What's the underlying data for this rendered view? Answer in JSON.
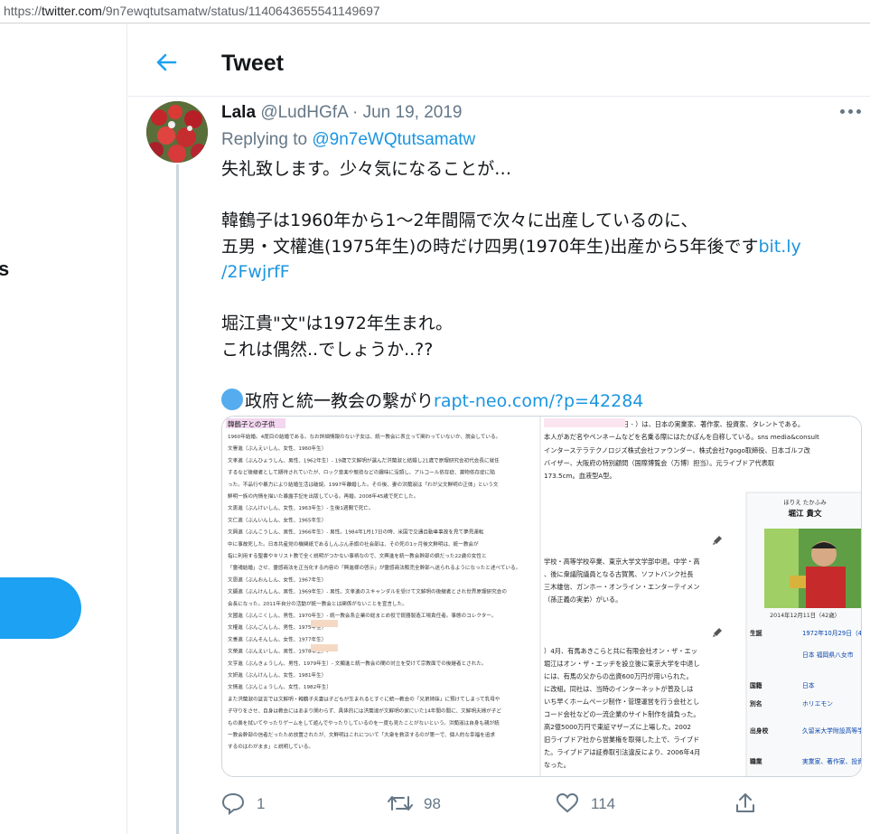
{
  "browser": {
    "url_prefix": "https://",
    "url_domain": "twitter.com",
    "url_path": "/9n7ewqtutsamatw/status/1140643655541149697"
  },
  "sidebar": {
    "fragment_text": "s"
  },
  "header": {
    "title": "Tweet"
  },
  "tweet": {
    "name": "Lala",
    "handle": "@LudHGfA",
    "separator": "·",
    "date": "Jun 19, 2019",
    "replying_prefix": "Replying to",
    "replying_to": "@9n7eWQtutsamatw",
    "lines": {
      "l1": "失礼致します。少々気になることが…",
      "l2": "韓鶴子は1960年から1～2年間隔で次々に出産しているのに、",
      "l3": "五男・文權進(1975年生)の時だけ四男(1970年生)出産から5年後です",
      "l3_link_a": "bit.ly",
      "l3_link_b": "/2FwjrfF",
      "l4": "堀江貴\"文\"は1972年生まれ。",
      "l5": "これは偶然..でしょうか..??",
      "l6": "政府と統一教会の繋がり",
      "l6_link": "rapt-neo.com/?p=42284"
    },
    "media": {
      "left_heading": "韓鶴子との子供",
      "left_lines": [
        "1960年結婚。4度目の結婚である。なお詳細情報のない子女は、統一教会に表立って関わっていないか、脱会している。",
        "文譽進（ぶんえいしん、女性、1960年生）",
        "文孝進（ぶんひょうしん、男性、1962年生）- 19歳で文鮮明が選んだ洪蘭淑と結婚し21歳で原理研究会初代会長に就任",
        "するなど後継者として期待されていたが、ロック音楽や競技などの趣味に没頭し、アルコール依存症、薬物依存症に陥",
        "った。不品行や暴力により結婚生活は破綻。1997年離婚した。その後、妻の洪蘭淑は「わが父文鮮明の正体」という文",
        "鮮明一族の内情を描いた暴露手記を出版している。再婚。2008年45歳で死亡した。",
        "文恵進（ぶんけいしん、女性、1963年生）- 生後1週間で死亡。",
        "文仁進（ぶんいんしん、女性、1965年生）",
        "文興進（ぶんこうしん、男性、1966年生）- 男性。1984年1月17日の時、米国で交通自動車事故を見て夢見運転",
        "中に事故死した。日本共産党の機関紙であるしんぶん赤旗の社会部は、その死の1ヶ月後文鮮明は、統一教会が",
        "指に利用する聖書やキリスト教で全く説明がつかない事柄なので、文興進を統一教会幹部の娘だった22歳の女性と",
        "「霊魂結婚」させ、霊感商法を正当化する内容の「興進様の啓示」が霊感商法販売全幹部へ送られるようになったと述べている。",
        "文恩進（ぶんおんしん、女性、1967年生）",
        "文顯進（ぶんけんしん、男性、1969年生）- 男性。文孝進のスキャンダルを受けて文鮮明の後継者とされ世界原理研究会の",
        "会長になった。2011年自分の活動が統一教会とは関係がないことを宣言した。",
        "文國進（ぶんこくしん、男性、1970年生）- 統一教会系企業の総まとめ役で銃器製造工場責任者。事態のコレクター。",
        "文權進（ぶんごんしん、男性、1975年生）",
        "文善進（ぶんそんしん、女性、1977年生）",
        "文榮進（ぶんえいしん、男性、1978年生）- ",
        "文亨進（ぶんきょうしん、男性、1979年生）- 文顯進と統一教会の間の対立を受けて宗教面での後継者とされた。",
        "文妍進（ぶんけんしん、女性、1981年生）",
        "文情進（ぶんじょうしん、女性、1982年生）",
        "また洪蘭淑の証言では文鮮明・韓鶴子夫妻は子どもが生まれるとすぐに統一教会の「兄弟姉妹」に預けてしまって乳母や",
        "子守りをさせ、自身は教会にはあまり関わらず、具体的には洪蘭淑が文鮮明の家にいた14年間の間に、文鮮明夫婦が子ど",
        "もの鼻を拭いてやったりゲームをして遊んでやったりしているのを一度も見たことがないという。洪蘭淑は自身も親が統",
        "一教会幹部の信者だったため放置されたが、文鮮明はこれについて「大衆を救済するのが第一で、個人的な幸福を追求",
        "するのはわがまま」と説明している。"
      ],
      "right_lines": [
        "たかふみ、1972年10月29日 - ）は、日本の実業家、著作家、投資家、タレントである。",
        "本人があだ名やペンネームなどを名乗る際にはたかぽんを自称している。sns media&consult",
        "インターステラテクノロジズ株式会社ファウンダー、株式会社7gogo取締役、日本ゴルフ改",
        "バイザー、大阪府の特別顧問（国際博覧会（万博）担当）。元ライブドア代表取",
        "173.5cm。血液型A型。",
        "学校・高等学校卒業、東京大学文学部中退。中学・高",
        "、後に衆議院議員となる古賀篤、ソフトバンク社長",
        "三木雄信、ガンホー・オンライン・エンターテイメン",
        "（孫正義の実弟）がいる。",
        "）4月、有馬あきこらと共に有限会社オン・ザ・エッ",
        "堀江はオン・ザ・エッヂを設立後に東京大学を中退し",
        "には、有馬の父からの出資600万円が用いられた。",
        "に改組。同社は、当時のインターネットが普及しは",
        "いち早くホームページ制作・管理運営を行う会社とし",
        "コード会社などの一流企業のサイト制作を請負った。",
        "高2億5000万円で東証マザーズに上場した。2002",
        "旧ライブドア社から営業権を取得した上で、ライブド",
        "た。ライブドアは証券取引法違反により、2006年4月",
        "なった。"
      ],
      "infobox": {
        "kana": "ほりえ たかふみ",
        "name": "堀江 貴文",
        "caption": "2014年12月11日（42歳）",
        "rows": [
          {
            "label": "生誕",
            "value": "1972年10月29日（46歳）"
          },
          {
            "label": "",
            "value": "日本 福岡県八女市"
          },
          {
            "label": "国籍",
            "value": "日本"
          },
          {
            "label": "別名",
            "value": "ホリエモン"
          },
          {
            "label": "出身校",
            "value": "久留米大学附設高等学校"
          },
          {
            "label": "職業",
            "value": "実業家、著作家、投資家、"
          }
        ]
      }
    },
    "stats": {
      "replies": "1",
      "retweets": "98",
      "likes": "114"
    }
  },
  "colors": {
    "brand": "#1da1f2",
    "link": "#1b95e0",
    "muted": "#657786",
    "border": "#e6ecf0"
  }
}
